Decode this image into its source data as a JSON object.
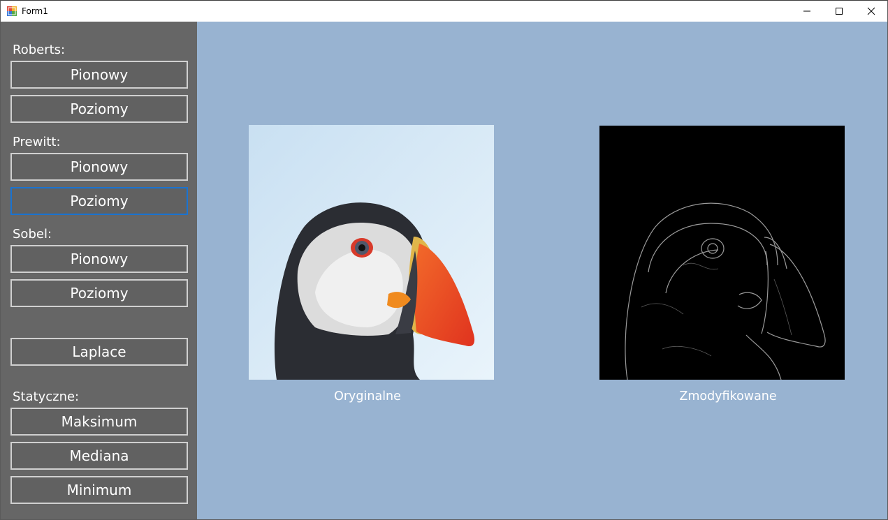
{
  "window": {
    "title": "Form1",
    "controls": {
      "minimize": "minimize-icon",
      "maximize": "maximize-icon",
      "close": "close-icon"
    }
  },
  "sidebar": {
    "sections": {
      "roberts": "Roberts:",
      "prewitt": "Prewitt:",
      "sobel": "Sobel:",
      "statyczne": "Statyczne:"
    },
    "buttons": {
      "roberts_vertical": "Pionowy",
      "roberts_horizontal": "Poziomy",
      "prewitt_vertical": "Pionowy",
      "prewitt_horizontal": "Poziomy",
      "sobel_vertical": "Pionowy",
      "sobel_horizontal": "Poziomy",
      "laplace": "Laplace",
      "maximum": "Maksimum",
      "median": "Mediana",
      "minimum": "Minimum"
    },
    "focused_button": "prewitt_horizontal"
  },
  "main": {
    "original_caption": "Oryginalne",
    "modified_caption": "Zmodyfikowane"
  },
  "colors": {
    "sidebar_bg": "#666666",
    "main_bg": "#98b3d1",
    "button_bg": "#616161",
    "button_border": "#d0d0d0",
    "focus_border": "#1a73d0"
  }
}
